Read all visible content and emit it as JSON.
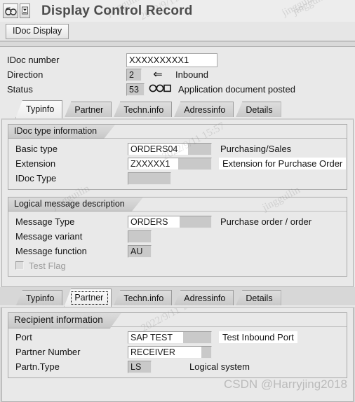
{
  "window": {
    "title": "Display Control Record",
    "icons": {
      "display_glasses": "glasses-icon",
      "dropdown": "chevron-down-icon"
    }
  },
  "toolbar": {
    "idoc_display_label": "IDoc Display"
  },
  "header": {
    "rows": [
      {
        "label": "IDoc number",
        "value": "XXXXXXXXX1",
        "icon": "",
        "desc": ""
      },
      {
        "label": "Direction",
        "value": "2",
        "icon": "⇐",
        "desc": "Inbound"
      },
      {
        "label": "Status",
        "value": "53",
        "icon": "status-traffic-icon",
        "desc": "Application document posted"
      }
    ]
  },
  "tabs_top": {
    "items": [
      {
        "label": "Typinfo",
        "active": true,
        "focused": false
      },
      {
        "label": "Partner",
        "active": false,
        "focused": false
      },
      {
        "label": "Techn.info",
        "active": false,
        "focused": false
      },
      {
        "label": "Adressinfo",
        "active": false,
        "focused": false
      },
      {
        "label": "Details",
        "active": false,
        "focused": false
      }
    ]
  },
  "typinfo": {
    "group_type": {
      "title": "IDoc type information",
      "rows": [
        {
          "label": "Basic type",
          "value": "ORDERS04",
          "desc": "Purchasing/Sales",
          "desc_highlight": false,
          "value_highlight": false
        },
        {
          "label": "Extension",
          "value": "ZXXXXX1",
          "desc": "Extension for Purchase Order",
          "desc_highlight": true,
          "value_highlight": true
        },
        {
          "label": "IDoc Type",
          "value": "",
          "desc": "",
          "desc_highlight": false,
          "value_highlight": false
        }
      ]
    },
    "group_message": {
      "title": "Logical message description",
      "rows": [
        {
          "label": "Message Type",
          "value": "ORDERS",
          "desc": "Purchase order / order",
          "desc_highlight": false,
          "value_highlight": false
        },
        {
          "label": "Message variant",
          "value": "",
          "desc": "",
          "desc_highlight": false,
          "value_highlight": false
        },
        {
          "label": "Message function",
          "value": "AU",
          "desc": "",
          "desc_highlight": false,
          "value_highlight": false
        }
      ],
      "test_flag_label": "Test Flag",
      "test_flag_checked": false
    }
  },
  "tabs_bottom": {
    "items": [
      {
        "label": "Typinfo",
        "active": false,
        "focused": false
      },
      {
        "label": "Partner",
        "active": true,
        "focused": true
      },
      {
        "label": "Techn.info",
        "active": false,
        "focused": false
      },
      {
        "label": "Adressinfo",
        "active": false,
        "focused": false
      },
      {
        "label": "Details",
        "active": false,
        "focused": false
      }
    ]
  },
  "partner": {
    "group_recipient": {
      "title": "Recipient information",
      "rows": [
        {
          "label": "Port",
          "value": "SAP TEST",
          "desc": "Test Inbound Port",
          "desc_highlight": true,
          "value_highlight": true
        },
        {
          "label": "Partner Number",
          "value": "RECEIVER",
          "desc": "",
          "desc_highlight": false,
          "value_highlight": true
        },
        {
          "label": "Partn.Type",
          "value": "LS",
          "desc": "Logical system",
          "desc_highlight": false,
          "value_highlight": false
        }
      ]
    }
  },
  "watermarks": {
    "author": "jingguilin",
    "date": "2022/9/11 15:57",
    "csdn": "CSDN @Harryjing2018"
  },
  "colors": {
    "window_bg": "#e9e9e9",
    "field_grey": "#c9c9c9",
    "highlight_white": "#ffffff",
    "title_text": "#4c4c4c"
  }
}
